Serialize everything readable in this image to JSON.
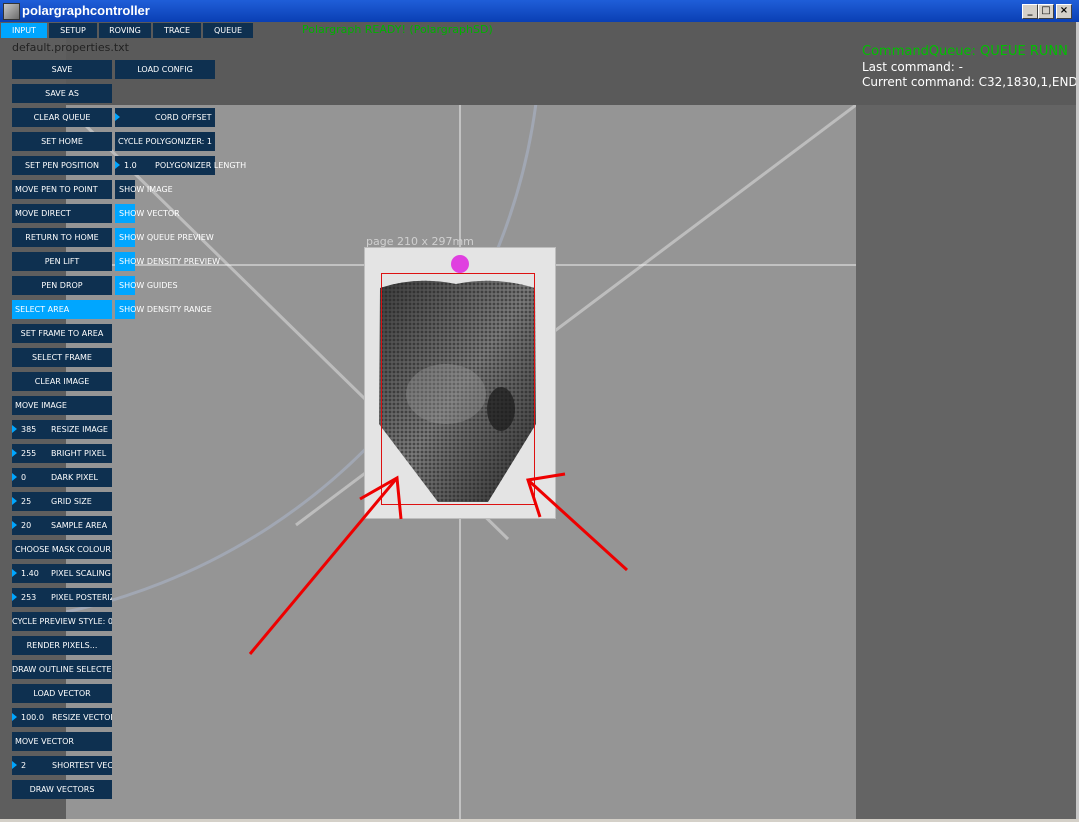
{
  "window": {
    "title": "polargraphcontroller",
    "min_glyph": "_",
    "max_glyph": "□",
    "close_glyph": "×"
  },
  "tabs": [
    {
      "label": "INPUT",
      "active": true
    },
    {
      "label": "SETUP"
    },
    {
      "label": "ROVING"
    },
    {
      "label": "TRACE"
    },
    {
      "label": "QUEUE"
    }
  ],
  "status": {
    "message": "Polargraph READY! (PolargraphSD)"
  },
  "properties_file": "default.properties.txt",
  "queue_info": {
    "command_queue": "CommandQueue: QUEUE RUNN",
    "last_command": "Last command: -",
    "current_command": "Current command: C32,1830,1,END"
  },
  "left_buttons": {
    "save": "SAVE",
    "save_as": "SAVE AS",
    "clear_queue": "CLEAR QUEUE",
    "set_home": "SET HOME",
    "set_pen_position": "SET PEN POSITION",
    "move_pen_to_point": "MOVE PEN TO POINT",
    "move_direct": "MOVE DIRECT",
    "return_to_home": "RETURN TO HOME",
    "pen_lift": "PEN LIFT",
    "pen_drop": "PEN DROP",
    "select_area": "SELECT AREA",
    "set_frame_to_area": "SET FRAME TO AREA",
    "select_frame": "SELECT FRAME",
    "clear_image": "CLEAR IMAGE",
    "move_image": "MOVE IMAGE",
    "choose_mask_colour": "CHOOSE MASK COLOUR",
    "cycle_preview_style": "CYCLE PREVIEW STYLE: 0",
    "render_pixels": "RENDER PIXELS...",
    "draw_outline_selected": "DRAW OUTLINE SELECTED",
    "load_vector": "LOAD VECTOR",
    "move_vector": "MOVE VECTOR",
    "draw_vectors": "DRAW VECTORS"
  },
  "numeric_controls": {
    "resize_image": {
      "value": "385",
      "label": "RESIZE IMAGE"
    },
    "bright_pixel": {
      "value": "255",
      "label": "BRIGHT PIXEL"
    },
    "dark_pixel": {
      "value": "0",
      "label": "DARK PIXEL"
    },
    "grid_size": {
      "value": "25",
      "label": "GRID SIZE"
    },
    "sample_area": {
      "value": "20",
      "label": "SAMPLE AREA"
    },
    "pixel_scaling": {
      "value": "1.40",
      "label": "PIXEL SCALING"
    },
    "pixel_posterize": {
      "value": "253",
      "label": "PIXEL POSTERIZE"
    },
    "resize_vector": {
      "value": "100.0",
      "label": "RESIZE VECTOR"
    },
    "shortest_vector": {
      "value": "2",
      "label": "SHORTEST VECTOR"
    },
    "polygonizer_length": {
      "value": "1.0",
      "label": "POLYGONIZER LENGTH"
    }
  },
  "right_buttons": {
    "load_config": "LOAD CONFIG",
    "cord_offset": "CORD OFFSET",
    "cycle_polygonizer": "CYCLE POLYGONIZER: 1"
  },
  "toggles": {
    "show_image": {
      "label": "SHOW IMAGE",
      "on": false
    },
    "show_vector": {
      "label": "SHOW VECTOR",
      "on": true
    },
    "show_queue_preview": {
      "label": "SHOW QUEUE PREVIEW",
      "on": true
    },
    "show_density_preview": {
      "label": "SHOW DENSITY PREVIEW",
      "on": true
    },
    "show_guides": {
      "label": "SHOW GUIDES",
      "on": true
    },
    "show_density_range": {
      "label": "SHOW DENSITY RANGE",
      "on": true
    }
  },
  "canvas": {
    "page_label": "page 210 x 297mm"
  },
  "colors": {
    "button_bg": "#0e3050",
    "active_blue": "#00a6ff",
    "status_green": "#00c000",
    "selection_red": "#dd1111",
    "annotation_red": "#ee0000",
    "pen_marker": "#e040e0"
  }
}
